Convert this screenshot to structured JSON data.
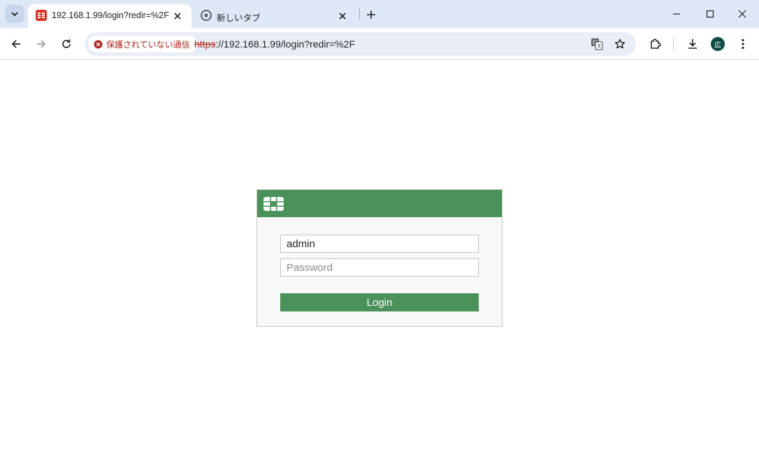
{
  "browser": {
    "tabs": [
      {
        "title": "192.168.1.99/login?redir=%2F",
        "active": true,
        "favicon": "fortinet-favicon"
      },
      {
        "title": "新しいタブ",
        "active": false,
        "favicon": "chrome-icon"
      }
    ],
    "security_chip": "保護されていない通信",
    "url_scheme": "https",
    "url_rest": "://192.168.1.99/login?redir=%2F",
    "profile_initial": "広"
  },
  "login": {
    "username_value": "admin",
    "password_placeholder": "Password",
    "login_label": "Login"
  },
  "colors": {
    "brand_green": "#4a9259",
    "insecure_red": "#b3261e",
    "tabbar": "#dfe8f6"
  }
}
